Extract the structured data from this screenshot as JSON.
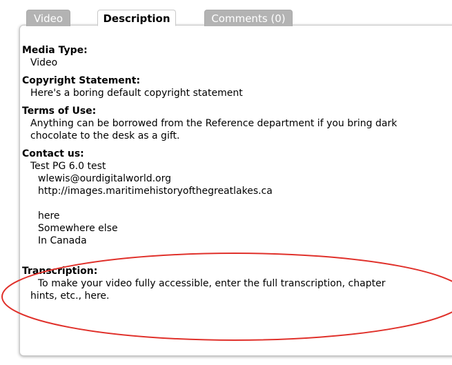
{
  "tabs": [
    {
      "label": "Video",
      "active": false
    },
    {
      "label": "Description",
      "active": true
    },
    {
      "label": "Comments (0)",
      "active": false
    }
  ],
  "fields": {
    "media_type": {
      "label": "Media Type:",
      "value": "Video"
    },
    "copyright": {
      "label": "Copyright Statement:",
      "value": "Here's a boring default copyright statement"
    },
    "terms": {
      "label": "Terms of Use:",
      "line1": "Anything can be borrowed from the Reference department if you bring dark",
      "line2": "chocolate to the desk as a gift."
    },
    "contact": {
      "label": "Contact us:",
      "name": "Test PG 6.0 test",
      "email": "wlewis@ourdigitalworld.org",
      "url": "http://images.maritimehistoryofthegreatlakes.ca",
      "address1": "here",
      "address2": "Somewhere else",
      "address3": "In Canada"
    },
    "transcription": {
      "label": "Transcription:",
      "line1": "To make your video fully accessible, enter the full transcription, chapter",
      "line2": "hints, etc., here."
    }
  },
  "colors": {
    "annotation_ellipse": "#e0302a",
    "inactive_tab": "#b3b3b3"
  }
}
